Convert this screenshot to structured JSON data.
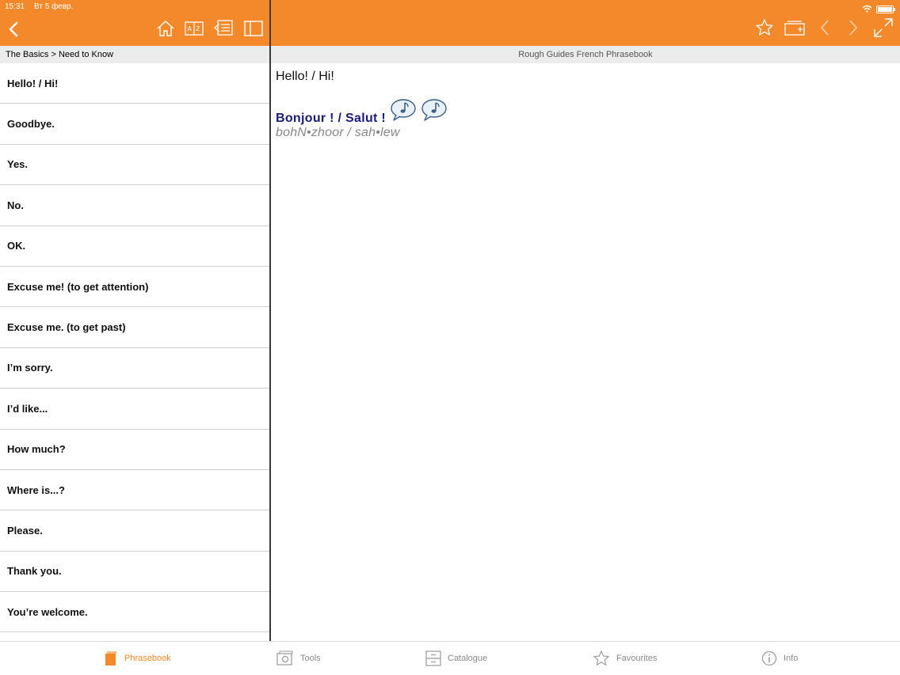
{
  "status": {
    "time": "15:31",
    "date": "Вт 5 февр."
  },
  "colors": {
    "accent": "#f3892a",
    "translation": "#1a1a7a",
    "pronunciation": "#888888"
  },
  "toolbar_left": {
    "back_icon": "chevron-left-icon",
    "icons": [
      "home-icon",
      "dictionary-icon",
      "phrase-list-icon",
      "book-icon"
    ]
  },
  "toolbar_right": {
    "icons": [
      "star-icon",
      "add-card-icon",
      "previous-icon",
      "next-icon",
      "expand-icon"
    ]
  },
  "sidebar": {
    "breadcrumb": "The Basics > Need to Know",
    "items": [
      {
        "label": "Hello! / Hi!"
      },
      {
        "label": "Goodbye."
      },
      {
        "label": "Yes."
      },
      {
        "label": "No."
      },
      {
        "label": "OK."
      },
      {
        "label": "Excuse me! (to get attention)"
      },
      {
        "label": "Excuse me. (to get past)"
      },
      {
        "label": "I’m sorry."
      },
      {
        "label": "I’d like..."
      },
      {
        "label": "How much?"
      },
      {
        "label": "Where is...?"
      },
      {
        "label": "Please."
      },
      {
        "label": "Thank you."
      },
      {
        "label": "You’re welcome."
      }
    ]
  },
  "main": {
    "header": "Rough Guides French Phrasebook",
    "phrase": "Hello! / Hi!",
    "translation": "Bonjour ! / Salut !",
    "pronunciation": "bohN•zhoor / sah•lew",
    "audio_icons": [
      "speech-audio-icon",
      "speech-audio-icon"
    ]
  },
  "tabbar": {
    "tabs": [
      {
        "label": "Phrasebook",
        "icon": "phrasebook-icon",
        "active": true
      },
      {
        "label": "Tools",
        "icon": "tools-icon",
        "active": false
      },
      {
        "label": "Catalogue",
        "icon": "catalogue-icon",
        "active": false
      },
      {
        "label": "Favourites",
        "icon": "star-outline-icon",
        "active": false
      },
      {
        "label": "Info",
        "icon": "info-icon",
        "active": false
      }
    ]
  }
}
